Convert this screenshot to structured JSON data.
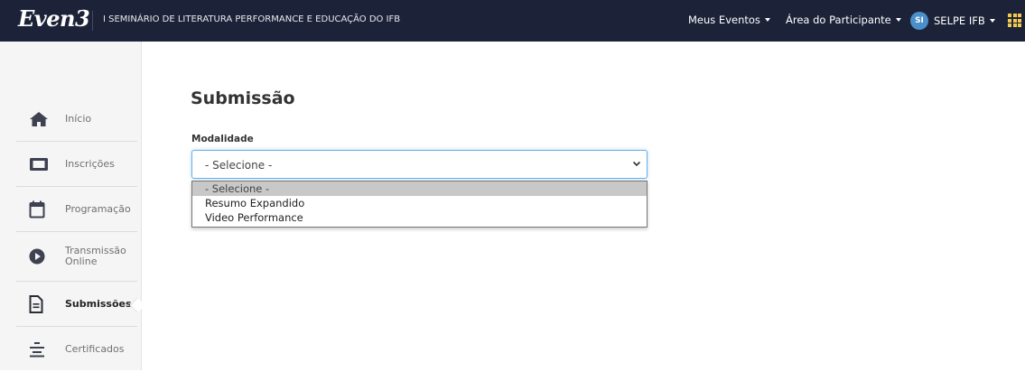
{
  "header": {
    "logo_text": "Even3",
    "event_title": "I SEMINÁRIO DE LITERATURA PERFORMANCE E EDUCAÇÃO DO IFB",
    "nav": {
      "my_events": "Meus Eventos",
      "participant_area": "Área do Participante",
      "user_initials": "SI",
      "user_name": "SELPE IFB"
    },
    "colors": {
      "bar": "#1c2338",
      "avatar": "#4a8fc9",
      "apps_icon": "#f2c94c"
    }
  },
  "sidebar": {
    "items": [
      {
        "label": "Início",
        "icon": "home-icon",
        "active": false
      },
      {
        "label": "Inscrições",
        "icon": "ticket-icon",
        "active": false
      },
      {
        "label": "Programação",
        "icon": "calendar-icon",
        "active": false
      },
      {
        "label": "Transmissão Online",
        "icon": "play-circle-icon",
        "active": false
      },
      {
        "label": "Submissões",
        "icon": "document-icon",
        "active": true
      },
      {
        "label": "Certificados",
        "icon": "certificate-icon",
        "active": false
      }
    ]
  },
  "main": {
    "title": "Submissão",
    "modalidade": {
      "label": "Modalidade",
      "selected": "- Selecione -",
      "options": [
        "- Selecione -",
        "Resumo Expandido",
        "Video Performance"
      ]
    }
  }
}
